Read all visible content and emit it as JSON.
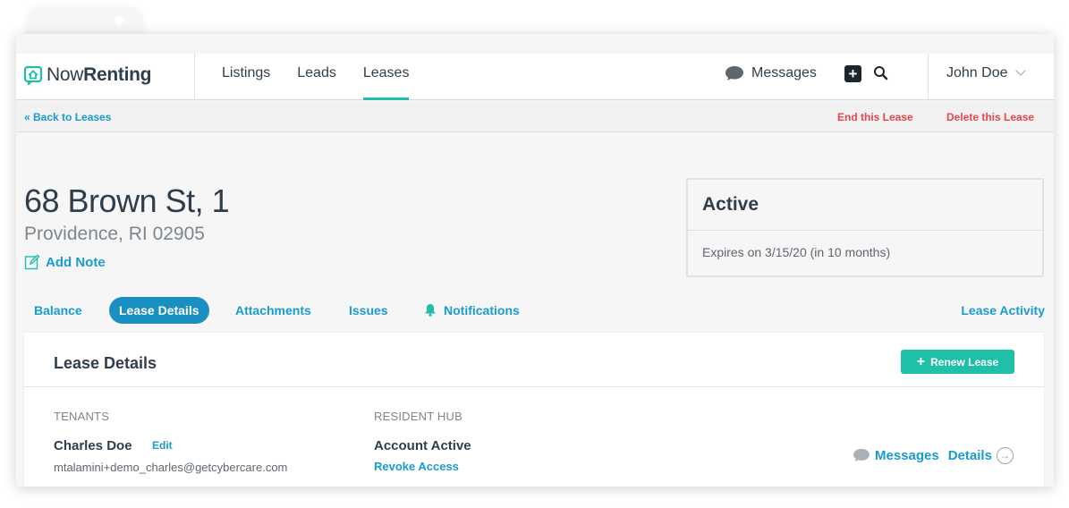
{
  "header": {
    "brand_prefix": "Now",
    "brand_suffix": "Renting",
    "nav": [
      {
        "label": "Listings",
        "active": false
      },
      {
        "label": "Leads",
        "active": false
      },
      {
        "label": "Leases",
        "active": true
      }
    ],
    "messages_label": "Messages",
    "add_icon": "plus-square-icon",
    "search_icon": "search-icon",
    "user_name": "John Doe"
  },
  "subbar": {
    "back_label": "« Back to Leases",
    "end_label": "End this Lease",
    "delete_label": "Delete this Lease"
  },
  "property": {
    "address": "68 Brown St, 1",
    "city": "Providence, RI 02905",
    "add_note_label": "Add Note"
  },
  "status": {
    "title": "Active",
    "expires": "Expires on 3/15/20 (in 10 months)"
  },
  "tabs": [
    {
      "label": "Balance"
    },
    {
      "label": "Lease Details",
      "active": true
    },
    {
      "label": "Attachments"
    },
    {
      "label": "Issues"
    },
    {
      "label": "Notifications",
      "icon": "bell-icon"
    }
  ],
  "lease_activity_label": "Lease Activity",
  "panel": {
    "title": "Lease Details",
    "renew_label": "Renew Lease",
    "tenants_heading": "TENANTS",
    "resident_hub_heading": "RESIDENT HUB",
    "tenant": {
      "name": "Charles Doe",
      "edit_label": "Edit",
      "email": "mtalamini+demo_charles@getcybercare.com"
    },
    "hub": {
      "status": "Account Active",
      "revoke_label": "Revoke Access"
    },
    "messages_label": "Messages",
    "details_label": "Details"
  },
  "colors": {
    "accent_teal": "#1fbfa8",
    "link_blue": "#1a9bcf",
    "danger_red": "#e5474b",
    "text_dark": "#2e3e4c"
  }
}
